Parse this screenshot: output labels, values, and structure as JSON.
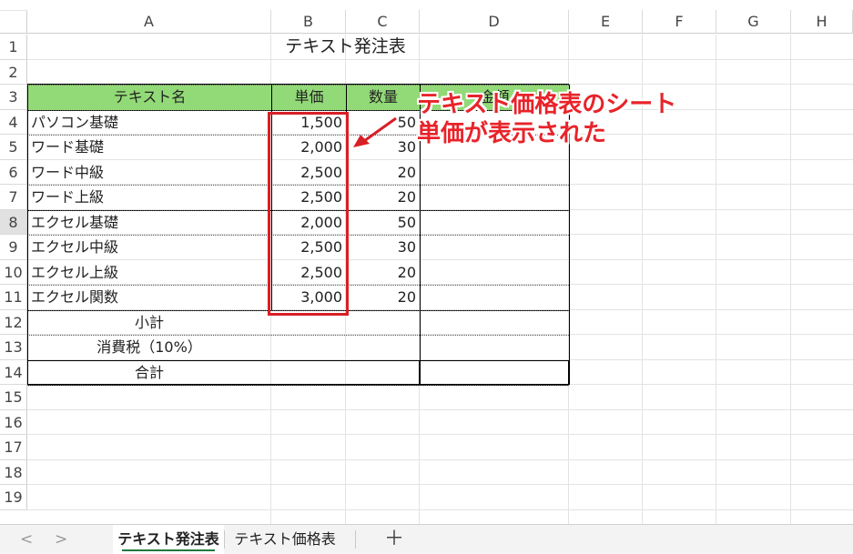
{
  "columns": [
    "A",
    "B",
    "C",
    "D",
    "E",
    "F",
    "G",
    "H"
  ],
  "rows": [
    "1",
    "2",
    "3",
    "4",
    "5",
    "6",
    "7",
    "8",
    "9",
    "10",
    "11",
    "12",
    "13",
    "14",
    "15",
    "16",
    "17",
    "18",
    "19"
  ],
  "title": "テキスト発注表",
  "headers": {
    "name": "テキスト名",
    "price": "単価",
    "qty": "数量",
    "amount": "金額"
  },
  "items": [
    {
      "name": "パソコン基礎",
      "price": "1,500",
      "qty": "50"
    },
    {
      "name": "ワード基礎",
      "price": "2,000",
      "qty": "30"
    },
    {
      "name": "ワード中級",
      "price": "2,500",
      "qty": "20"
    },
    {
      "name": "ワード上級",
      "price": "2,500",
      "qty": "20"
    },
    {
      "name": "エクセル基礎",
      "price": "2,000",
      "qty": "50"
    },
    {
      "name": "エクセル中級",
      "price": "2,500",
      "qty": "30"
    },
    {
      "name": "エクセル上級",
      "price": "2,500",
      "qty": "20"
    },
    {
      "name": "エクセル関数",
      "price": "3,000",
      "qty": "20"
    }
  ],
  "summary": {
    "subtotal": "小計",
    "tax": "消費税（10%）",
    "total": "合計"
  },
  "callout": {
    "line1": "テキスト価格表のシート",
    "line2": "単価が表示された",
    "color": "#e8232a"
  },
  "sheet_tabs": [
    {
      "label": "テキスト発注表",
      "active": true
    },
    {
      "label": "テキスト価格表",
      "active": false
    }
  ],
  "add_sheet": "＋",
  "nav": {
    "prev": "<",
    "next": ">"
  },
  "colors": {
    "header_fill": "#92d977",
    "highlight": "#d81f26",
    "tab_underline": "#1f7a3d"
  }
}
